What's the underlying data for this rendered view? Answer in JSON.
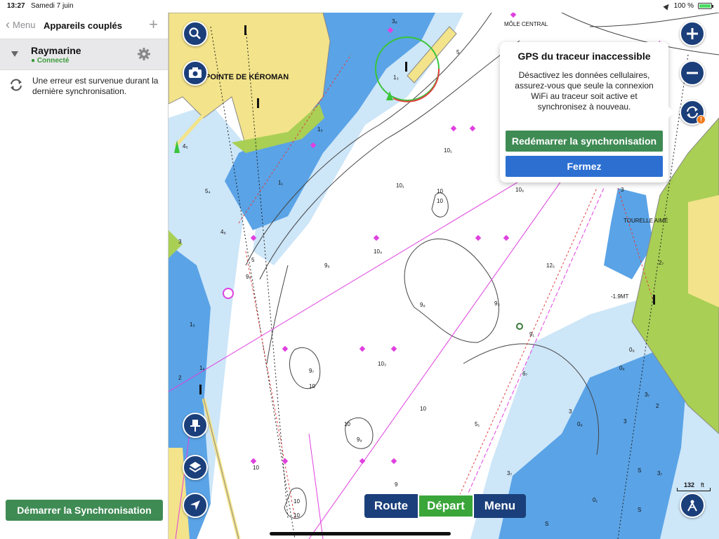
{
  "status_bar": {
    "time": "13:27",
    "date": "Samedi 7 juin",
    "battery": "100 %",
    "battery_level": 1.0
  },
  "sidebar": {
    "back_label": "Menu",
    "title": "Appareils couplés",
    "add_icon": "plus-icon",
    "device": {
      "name": "Raymarine",
      "status": "● Connecté",
      "settings_icon": "gear-icon"
    },
    "error_message": "Une erreur est survenue durant la dernière synchronisation.",
    "start_sync_label": "Démarrer la Synchronisation"
  },
  "map": {
    "labels": {
      "pointe": "POINTE DE KÉROMAN",
      "mole": "MÔLE CENTRAL",
      "tourelle": "TOURELLE AIMÉ",
      "mt": "-1.9MT"
    },
    "depths": [
      "3₈",
      "5",
      "1₃",
      "1₅",
      "4₅",
      "1₁",
      "5₄",
      "4₈",
      "3",
      "5",
      "9₅",
      "9₆",
      "10₁",
      "10₁",
      "10",
      "10",
      "10₄",
      "10₉",
      "12₅",
      "9₈",
      "9₃",
      "9₁",
      "1₅",
      "1₉",
      "9₇",
      "10",
      "10₃",
      "6₇",
      "2",
      "10",
      "10",
      "9₉",
      "5₁",
      "3",
      "0₆",
      "3₇",
      "10",
      "9",
      "10",
      "10",
      "3",
      "2",
      "2₇",
      "0₈",
      "0₉",
      "3₇",
      "3",
      "S",
      "S",
      "0₁",
      "S",
      "3₇"
    ],
    "popup": {
      "title": "GPS du traceur inaccessible",
      "body": "Désactivez les données cellulaires, assurez-vous que seule la connexion WiFi au traceur soit active et synchronisez à nouveau.",
      "restart_label": "Redémarrer la synchronisation",
      "close_label": "Fermez"
    },
    "bottom_bar": {
      "route": "Route",
      "depart": "Départ",
      "menu": "Menu"
    },
    "scale": {
      "value": "132",
      "unit": "ft"
    },
    "icons": {
      "search": "search-icon",
      "camera": "camera-icon",
      "zoom_in": "plus-icon",
      "zoom_out": "minus-icon",
      "sync": "sync-icon",
      "pin": "pin-icon",
      "layers": "layers-icon",
      "locate": "navigation-arrow-icon",
      "compass": "compass-icon"
    },
    "colors": {
      "land": "#f3e38a",
      "land_green": "#a9cf55",
      "deep_blue": "#5aa3e6",
      "light_blue": "#cde6f8",
      "button_blue": "#1b3f7a",
      "green_button": "#3f8b54",
      "close_blue": "#2c6fd1",
      "active_green": "#3aa63a"
    }
  }
}
